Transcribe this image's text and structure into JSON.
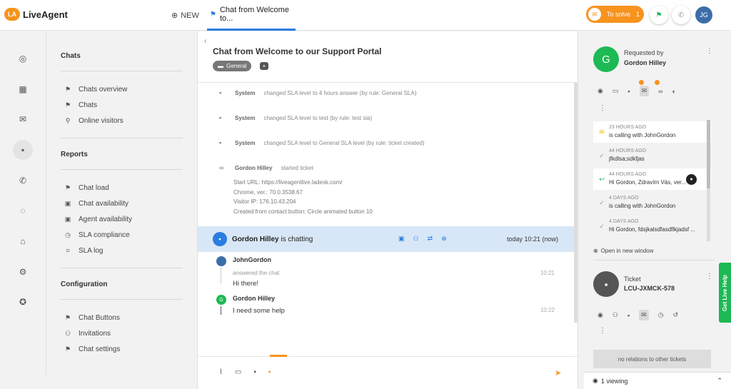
{
  "app": {
    "name": "LiveAgent",
    "logo_mark": "LA"
  },
  "topbar": {
    "new_label": "NEW",
    "tab_label": "Chat from Welcome to...",
    "to_solve_label": "To solve",
    "to_solve_count": "1",
    "avatar_initials": "JG"
  },
  "nav": {
    "chats_heading": "Chats",
    "chats_items": [
      {
        "label": "Chats overview",
        "icon": "flag-icon"
      },
      {
        "label": "Chats",
        "icon": "flag-icon"
      },
      {
        "label": "Online visitors",
        "icon": "pin-icon"
      }
    ],
    "reports_heading": "Reports",
    "reports_items": [
      {
        "label": "Chat load",
        "icon": "flag-icon"
      },
      {
        "label": "Chat availability",
        "icon": "calendar-icon"
      },
      {
        "label": "Agent availability",
        "icon": "calendar-icon"
      },
      {
        "label": "SLA compliance",
        "icon": "clock-icon"
      },
      {
        "label": "SLA log",
        "icon": "crop-icon"
      }
    ],
    "config_heading": "Configuration",
    "config_items": [
      {
        "label": "Chat Buttons",
        "icon": "flag-icon"
      },
      {
        "label": "Invitations",
        "icon": "user-plus-icon"
      },
      {
        "label": "Chat settings",
        "icon": "flag-icon"
      }
    ]
  },
  "ticket": {
    "title": "Chat from Welcome to our Support Portal",
    "tag": "General"
  },
  "feed": {
    "sys1_actor": "System",
    "sys1_text": "changed SLA level to 4 hours answer (by rule: General SLA)",
    "sys2_actor": "System",
    "sys2_text": "changed SLA level to test (by rule: test sla)",
    "sys3_actor": "System",
    "sys3_text": "changed SLA level to General SLA level (by rule: ticket created)",
    "start_actor": "Gordon Hilley",
    "start_text": "started ticket",
    "info_lines": [
      "Start URL: https://liveagentlive.ladesk.com/",
      "Chrome, ver.: 70.0.3538.67",
      "Visitor IP: 176.10.43.204",
      "Created from contact button: Circle animated button 10"
    ],
    "chatting_name": "Gordon Hilley",
    "chatting_text": "is chatting",
    "chatting_time": "today 10:21 (now)",
    "msg1_name": "JohnGordon",
    "msg1_sub": "answered the chat",
    "msg1_text": "Hi there!",
    "msg1_time": "10:21",
    "msg2_initial": "G",
    "msg2_name": "Gordon Hilley",
    "msg2_text": "I need some help",
    "msg2_time": "10:22"
  },
  "right": {
    "requester_initial": "G",
    "requested_by": "Requested by",
    "requester_name": "Gordon Hilley",
    "timeline": [
      {
        "time": "23 HOURS AGO",
        "text": "is calling with JohnGordon",
        "icon": "mail-icon",
        "highlight": true
      },
      {
        "time": "44 HOURS AGO",
        "text": "jfkdlsa;sdkfjas",
        "icon": "check-icon",
        "highlight": false
      },
      {
        "time": "44 HOURS AGO",
        "text": "Hi Gordon, Zdravím Vás, ver...",
        "icon": "reply-icon",
        "highlight": true
      },
      {
        "time": "4 DAYS AGO",
        "text": "is calling with JohnGordon",
        "icon": "check-icon",
        "highlight": false
      },
      {
        "time": "4 DAYS AGO",
        "text": "Hi Gordon, fdsjkalsdfasdflkjadsf ...",
        "icon": "check-icon",
        "highlight": false
      }
    ],
    "open_new": "Open in new window",
    "ticket_label": "Ticket",
    "ticket_id": "LCU-JXMCK-578",
    "no_relations": "no relations to other tickets",
    "viewing": "1 viewing"
  },
  "live_help": "Get Live Help",
  "colors": {
    "accent": "#f7931e",
    "primary": "#2a7de1",
    "green": "#1db954"
  }
}
